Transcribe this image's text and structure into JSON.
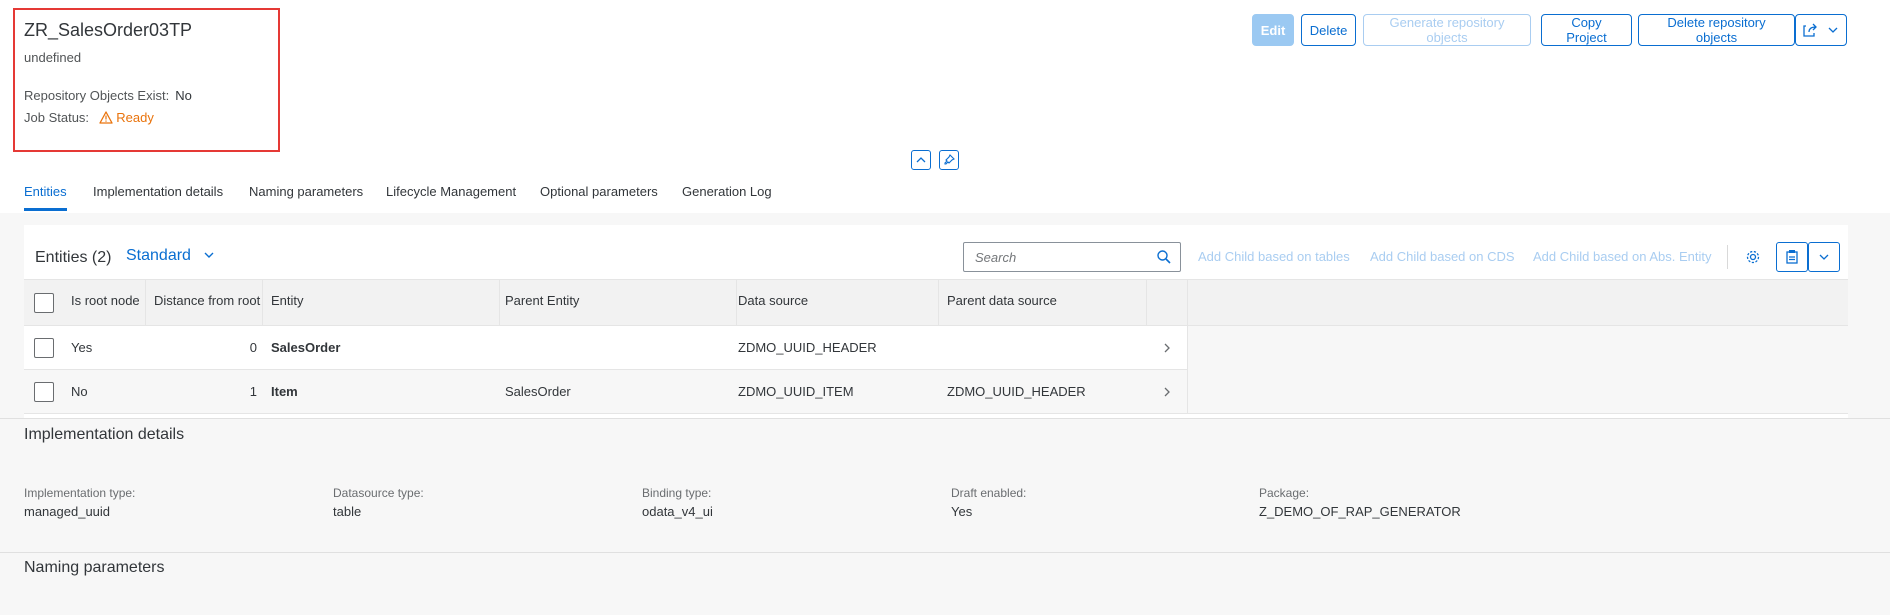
{
  "header": {
    "title": "ZR_SalesOrder03TP",
    "subtitle": "undefined",
    "attributes": [
      {
        "label": "Repository Objects Exist:",
        "value": "No"
      },
      {
        "label": "Job Status:",
        "value": "Ready",
        "status": "warning"
      }
    ],
    "actions": {
      "edit": "Edit",
      "delete": "Delete",
      "generate": "Generate repository objects",
      "copy": "Copy Project",
      "delete_repo": "Delete repository objects"
    }
  },
  "tabs": [
    {
      "label": "Entities",
      "active": true
    },
    {
      "label": "Implementation details"
    },
    {
      "label": "Naming parameters"
    },
    {
      "label": "Lifecycle Management"
    },
    {
      "label": "Optional parameters"
    },
    {
      "label": "Generation Log"
    }
  ],
  "entities": {
    "title": "Entities (2)",
    "variant": "Standard",
    "search_placeholder": "Search",
    "toolbar_links": [
      "Add Child based on tables",
      "Add Child based on CDS",
      "Add Child based on Abs. Entity"
    ],
    "columns": [
      "Is root node",
      "Distance from root",
      "Entity",
      "Parent Entity",
      "Data source",
      "Parent data source"
    ],
    "rows": [
      {
        "is_root": "Yes",
        "distance": "0",
        "entity": "SalesOrder",
        "parent": "",
        "datasource": "ZDMO_UUID_HEADER",
        "parent_ds": ""
      },
      {
        "is_root": "No",
        "distance": "1",
        "entity": "Item",
        "parent": "SalesOrder",
        "datasource": "ZDMO_UUID_ITEM",
        "parent_ds": "ZDMO_UUID_HEADER"
      }
    ]
  },
  "implementation": {
    "title": "Implementation details",
    "fields": [
      {
        "label": "Implementation type:",
        "value": "managed_uuid"
      },
      {
        "label": "Datasource type:",
        "value": "table"
      },
      {
        "label": "Binding type:",
        "value": "odata_v4_ui"
      },
      {
        "label": "Draft enabled:",
        "value": "Yes"
      },
      {
        "label": "Package:",
        "value": "Z_DEMO_OF_RAP_GENERATOR"
      }
    ]
  },
  "naming": {
    "title": "Naming parameters"
  },
  "colors": {
    "accent": "#0a6ed1",
    "warning": "#e9730c",
    "highlight": "#e53935"
  }
}
